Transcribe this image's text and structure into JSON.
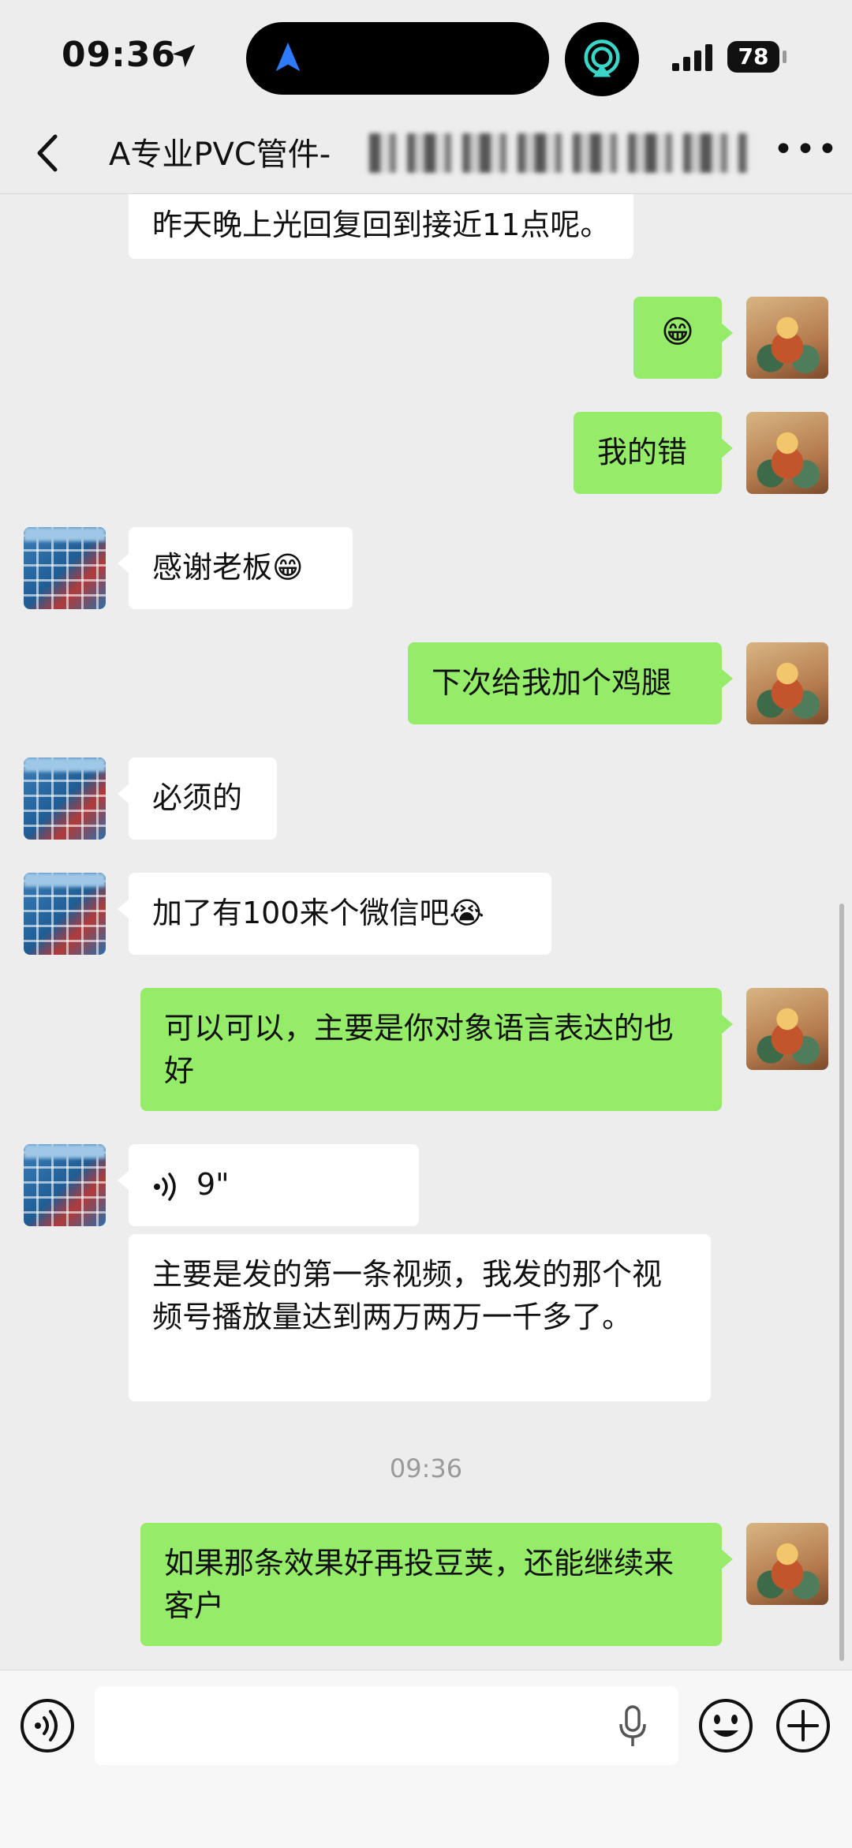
{
  "status_bar": {
    "time": "09:36",
    "battery": "78"
  },
  "header": {
    "title": "A专业PVC管件-"
  },
  "messages": [
    {
      "from": "other",
      "text": "昨天晚上光回复回到接近11点呢。"
    },
    {
      "from": "me",
      "text": "😁"
    },
    {
      "from": "me",
      "text": "我的错"
    },
    {
      "from": "other",
      "text": "感谢老板😁"
    },
    {
      "from": "me",
      "text": "下次给我加个鸡腿"
    },
    {
      "from": "other",
      "text": "必须的"
    },
    {
      "from": "other",
      "text": "加了有100来个微信吧😭"
    },
    {
      "from": "me",
      "text": "可以可以，主要是你对象语言表达的也好"
    },
    {
      "from": "other",
      "type": "voice",
      "text": "9\""
    },
    {
      "from": "other",
      "text": "主要是发的第一条视频，我发的那个视频号播放量达到两万两万一千多了。"
    },
    {
      "from": "me",
      "text": "如果那条效果好再投豆荚，还能继续来客户"
    }
  ],
  "timestamp": "09:36",
  "colors": {
    "background": "#ededed",
    "bubble_out": "#95ec69",
    "bubble_in": "#ffffff"
  }
}
